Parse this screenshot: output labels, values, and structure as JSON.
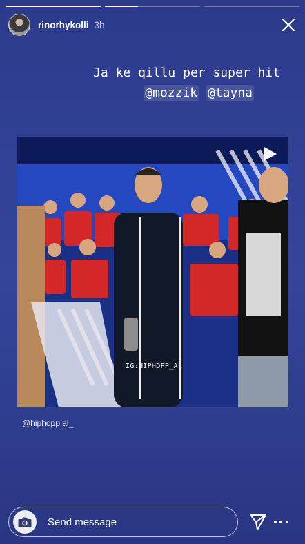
{
  "story": {
    "username": "rinorhykolli",
    "time_ago": "3h",
    "segments": [
      {
        "progress": 1.0
      },
      {
        "progress": 0.35
      },
      {
        "progress": 0.0
      }
    ]
  },
  "caption": {
    "line1": "Ja ke qillu per super hit",
    "mention1": "@mozzik",
    "mention2": "@tayna"
  },
  "video": {
    "watermark": "IG:HIPHOPP_AL",
    "credit": "@hiphopp.al_"
  },
  "footer": {
    "message_placeholder": "Send message"
  },
  "icons": [
    "camera-icon",
    "send-icon",
    "more-icon",
    "close-icon",
    "play-icon"
  ]
}
